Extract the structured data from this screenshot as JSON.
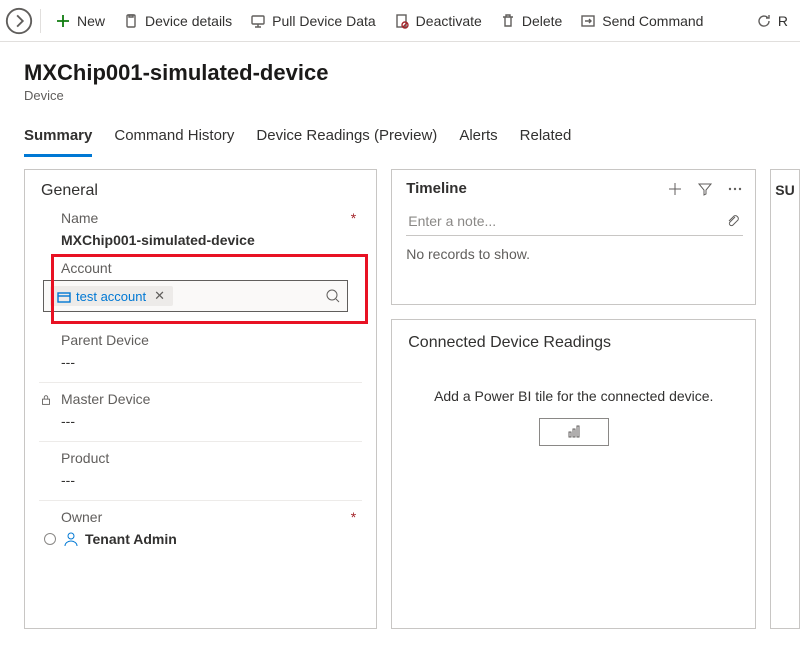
{
  "toolbar": {
    "new": "New",
    "details": "Device details",
    "pull": "Pull Device Data",
    "deactivate": "Deactivate",
    "delete": "Delete",
    "send": "Send Command",
    "refresh": "R"
  },
  "header": {
    "title": "MXChip001-simulated-device",
    "subtitle": "Device"
  },
  "tabs": {
    "summary": "Summary",
    "history": "Command History",
    "readings": "Device Readings (Preview)",
    "alerts": "Alerts",
    "related": "Related"
  },
  "general": {
    "title": "General",
    "name_label": "Name",
    "name_value": "MXChip001-simulated-device",
    "account_label": "Account",
    "account_value": "test account",
    "parent_label": "Parent Device",
    "parent_value": "---",
    "master_label": "Master Device",
    "master_value": "---",
    "product_label": "Product",
    "product_value": "---",
    "owner_label": "Owner",
    "owner_value": "Tenant Admin"
  },
  "timeline": {
    "title": "Timeline",
    "placeholder": "Enter a note...",
    "empty": "No records to show."
  },
  "readings_panel": {
    "title": "Connected Device Readings",
    "message": "Add a Power BI tile for the connected device."
  },
  "suggestions_label": "SU"
}
